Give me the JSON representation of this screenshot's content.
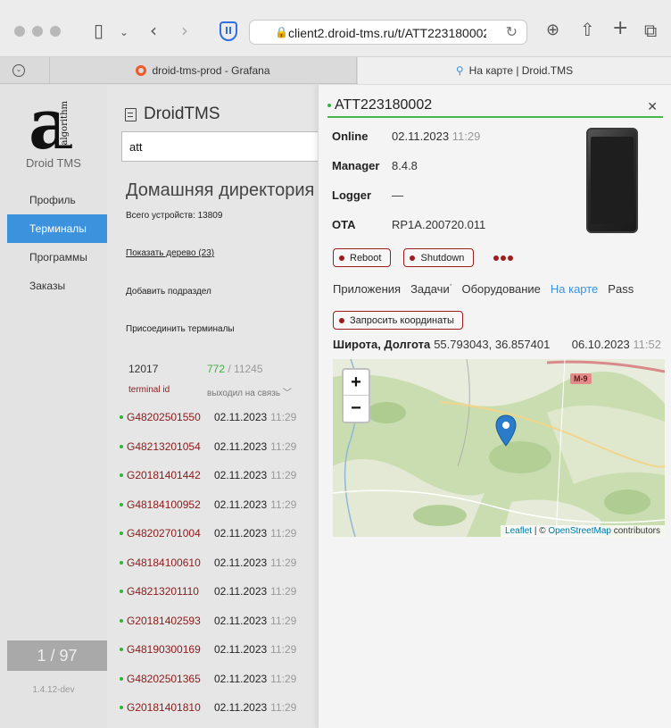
{
  "browser": {
    "url": "client2.droid-tms.ru/t/ATT223180002/",
    "tabs": [
      {
        "label": "droid-tms-prod - Grafana"
      },
      {
        "label": "На карте | Droid.TMS"
      }
    ]
  },
  "sidebar": {
    "logo_caption": "Droid TMS",
    "logo_letter": "a",
    "logo_vertical": "algorithm",
    "items": [
      {
        "label": "Профиль"
      },
      {
        "label": "Терминалы"
      },
      {
        "label": "Программы"
      },
      {
        "label": "Заказы"
      }
    ],
    "pager": "1 / 97",
    "version": "1.4.12-dev"
  },
  "main": {
    "brand": "DroidTMS",
    "search_value": "att",
    "home_title": "Домашняя директория",
    "total_devices": "Всего устройств: 13809",
    "show_tree": "Показать дерево (23)",
    "add_subsection": "Добавить подраздел",
    "attach_terminals": "Присоединить терминалы",
    "count": "12017",
    "online_count": "772",
    "online_sep": " / ",
    "online_total": "11245",
    "col_terminal": "terminal id",
    "col_contact": "выходил на связь",
    "rows": [
      {
        "id": "G48202501550",
        "date": "02.11.2023",
        "time": "11:29"
      },
      {
        "id": "G48213201054",
        "date": "02.11.2023",
        "time": "11:29"
      },
      {
        "id": "G20181401442",
        "date": "02.11.2023",
        "time": "11:29"
      },
      {
        "id": "G48184100952",
        "date": "02.11.2023",
        "time": "11:29"
      },
      {
        "id": "G48202701004",
        "date": "02.11.2023",
        "time": "11:29"
      },
      {
        "id": "G48184100610",
        "date": "02.11.2023",
        "time": "11:29"
      },
      {
        "id": "G48213201110",
        "date": "02.11.2023",
        "time": "11:29"
      },
      {
        "id": "G20181402593",
        "date": "02.11.2023",
        "time": "11:29"
      },
      {
        "id": "G48190300169",
        "date": "02.11.2023",
        "time": "11:29"
      },
      {
        "id": "G48202501365",
        "date": "02.11.2023",
        "time": "11:29"
      },
      {
        "id": "G20181401810",
        "date": "02.11.2023",
        "time": "11:29"
      }
    ]
  },
  "panel": {
    "title": "ATT223180002",
    "info": {
      "online_label": "Online",
      "online_date": "02.11.2023",
      "online_time": "11:29",
      "manager_label": "Manager",
      "manager_value": "8.4.8",
      "logger_label": "Logger",
      "logger_value": "—",
      "ota_label": "OTA",
      "ota_value": "RP1A.200720.011"
    },
    "reboot_label": "Reboot",
    "shutdown_label": "Shutdown",
    "tabs": [
      {
        "label": "Приложения"
      },
      {
        "label": "Задачи"
      },
      {
        "label": "Оборудование"
      },
      {
        "label": "На карте"
      },
      {
        "label": "Pass"
      }
    ],
    "tasks_marker": "*",
    "request_coords_label": "Запросить координаты",
    "coords_label": "Широта, Долгота",
    "coords_value": "55.793043, 36.857401",
    "coords_date": "06.10.2023",
    "coords_time": "11:52",
    "map": {
      "zoom_in": "+",
      "zoom_out": "−",
      "road_label": "M-9",
      "attr_leaflet": "Leaflet",
      "attr_sep": " | © ",
      "attr_osm": "OpenStreetMap",
      "attr_tail": " contributors"
    }
  },
  "colors": {
    "accent": "#3d92de",
    "online": "#3bb143",
    "danger": "#9b1d1d",
    "terminal_id": "#8b1a1a",
    "marker": "#2a7ccb"
  }
}
